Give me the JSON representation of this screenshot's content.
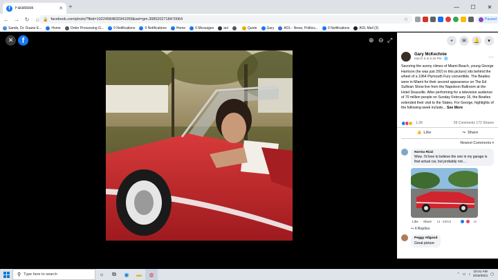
{
  "browser": {
    "tab_title": "Facebook",
    "url": "facebook.com/photo/?fbid=10224584832941059&set=gm.3085202718470064",
    "bookmarks": [
      {
        "label": "Sands, Dr. Duane E...",
        "color": "#4a90d9"
      },
      {
        "label": "Home",
        "color": "#1877f2"
      },
      {
        "label": "Order Processing G...",
        "color": "#555555"
      },
      {
        "label": "0 Notifications",
        "color": "#1877f2"
      },
      {
        "label": "0 Notifications",
        "color": "#1877f2"
      },
      {
        "label": "Home",
        "color": "#1877f2"
      },
      {
        "label": "0 Messages",
        "color": "#1877f2"
      },
      {
        "label": "aol",
        "color": "#333333"
      },
      {
        "label": "",
        "color": "#555555"
      },
      {
        "label": "Quote",
        "color": "#e2b007"
      },
      {
        "label": "Gary",
        "color": "#1877f2"
      },
      {
        "label": "AOL - News, Politics...",
        "color": "#3d6bd4"
      },
      {
        "label": "0 Notifications",
        "color": "#1877f2"
      },
      {
        "label": "AOL Mail (3)",
        "color": "#222222"
      }
    ],
    "profile_status": "Paused"
  },
  "post": {
    "author": "Gary McKechnie",
    "date": "March 8 at 5:46 PM · ",
    "text": "Savoring the sunny climes of Miami Beach, young George Harrison (he was just 20(!) in this picture) sits behind the wheel of a 1964 Plymouth Fury convertible. The Beatles were in Miami for their second appearance on The Ed Sullivan Show live from the Napoleon Ballroom at the Hotel Deauville. After performing for a television audience of 70 million people on Sunday February 16, the Beatles extended their visit to the States. For George, highlights of the following week include... ",
    "see_more": "See More",
    "reaction_count": "1.2K",
    "comments_count": "59 Comments",
    "shares_count": "172 Shares",
    "like_label": "Like",
    "share_label": "Share",
    "sort_label": "Newest Comments"
  },
  "comments": [
    {
      "name": "Norma Rizzi",
      "text": "Wow. I'd love to believe the one in my garage is that actual car, but probably not....",
      "like": "Like",
      "reply": "Share",
      "time": "1d · Edited",
      "reactions": "15",
      "replies": "4 Replies"
    },
    {
      "name": "Peggy Allgood",
      "text": "Great picture"
    }
  ],
  "taskbar": {
    "search_placeholder": "Type here to search",
    "time": "10:41 AM",
    "date": "3/10/2021"
  },
  "colors": {
    "facebook_blue": "#1877f2",
    "car_red": "#c8252b"
  }
}
